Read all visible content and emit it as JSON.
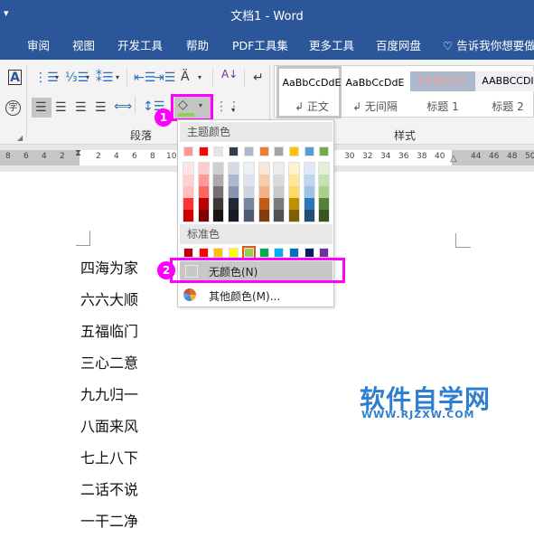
{
  "titlebar": {
    "quick_access": "▾",
    "title": "文档1  -  Word"
  },
  "tabs": [
    {
      "label": "审阅"
    },
    {
      "label": "视图"
    },
    {
      "label": "开发工具"
    },
    {
      "label": "帮助"
    },
    {
      "label": "PDF工具集"
    },
    {
      "label": "更多工具"
    },
    {
      "label": "百度网盘"
    }
  ],
  "tell_me": {
    "icon": "lightbulb-icon",
    "text": "告诉我你想要做"
  },
  "ribbon": {
    "paragraph_group_label": "段落",
    "styles_group_label": "样式",
    "styles": [
      {
        "sample": "AaBbCcDdE",
        "name": "↲ 正文",
        "active": true
      },
      {
        "sample": "AaBbCcDdE",
        "name": "↲ 无间隔",
        "active": false
      },
      {
        "sample": "AABBCCI",
        "name": "标题 1",
        "active": false
      },
      {
        "sample": "AABBCCDI",
        "name": "标题 2",
        "active": false
      }
    ],
    "shading_color": "#92d050"
  },
  "ruler": {
    "left_numbers": [
      "8",
      "6",
      "4",
      "2"
    ],
    "numbers": [
      "2",
      "4",
      "6",
      "8",
      "10"
    ],
    "right_numbers": [
      "30",
      "32",
      "34",
      "36",
      "38",
      "40"
    ],
    "margin_numbers": [
      "44",
      "46",
      "48",
      "50"
    ]
  },
  "annotations": {
    "badge1": "1",
    "badge2": "2",
    "highlight_color": "#ff00ff"
  },
  "dropdown": {
    "theme_header": "主题颜色",
    "theme_colors": [
      "#ff9999",
      "#ff0000",
      "#e7e6e6",
      "#323f4f",
      "#acb9ca",
      "#ed7d31",
      "#a5a5a5",
      "#ffc000",
      "#5b9bd5",
      "#70ad47"
    ],
    "theme_shades": [
      [
        "#ffe5e5",
        "#ffd1d1",
        "#ffbfbf",
        "#ff3333",
        "#cc0000"
      ],
      [
        "#ffcccc",
        "#ff9999",
        "#ff6666",
        "#c00000",
        "#800000"
      ],
      [
        "#d0cece",
        "#aeaaaa",
        "#757171",
        "#3a3838",
        "#171616"
      ],
      [
        "#d6dce4",
        "#adb9ca",
        "#8496b0",
        "#222a35",
        "#161c23"
      ],
      [
        "#edf0f5",
        "#dee3eb",
        "#cdd5e0",
        "#74879f",
        "#4e5b73"
      ],
      [
        "#fbe5d5",
        "#f8cbad",
        "#f4b183",
        "#c55a11",
        "#833c0b"
      ],
      [
        "#ededed",
        "#dbdbdb",
        "#c9c9c9",
        "#7b7b7b",
        "#525252"
      ],
      [
        "#fff2cc",
        "#ffe699",
        "#ffd966",
        "#bf9000",
        "#7f6000"
      ],
      [
        "#deebf6",
        "#bdd7ee",
        "#9dc3e6",
        "#2e75b5",
        "#1f4e79"
      ],
      [
        "#e2efd9",
        "#c5e0b3",
        "#a8d08d",
        "#538135",
        "#375623"
      ]
    ],
    "standard_header": "标准色",
    "standard_colors": [
      "#c00000",
      "#ff0000",
      "#ffc000",
      "#ffff00",
      "#92d050",
      "#00b050",
      "#00b0f0",
      "#0070c0",
      "#002060",
      "#7030a0"
    ],
    "standard_selected_index": 4,
    "no_color_label": "无颜色(N)",
    "more_colors_label": "其他颜色(M)..."
  },
  "document": {
    "lines": [
      "四海为家",
      "六六大顺",
      "五福临门",
      "三心二意",
      "九九归一",
      "八面来风",
      "七上八下",
      "二话不说",
      "一干二净"
    ]
  },
  "watermark": {
    "cn": "软件自学网",
    "en": "WWW.RJZXW.COM"
  }
}
